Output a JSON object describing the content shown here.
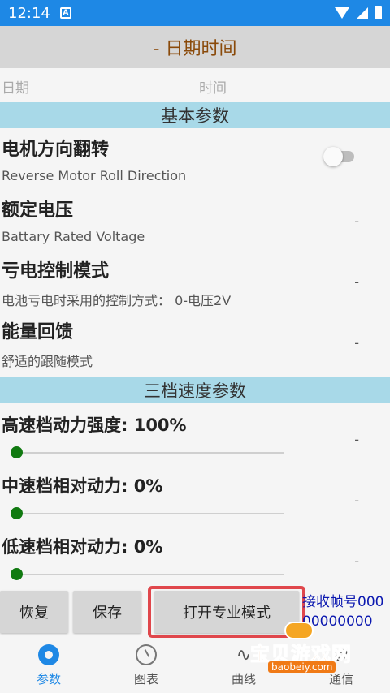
{
  "status_bar": {
    "time": "12:14",
    "notif_icon": "A"
  },
  "header": {
    "title": "- 日期时间"
  },
  "datetime": {
    "date_label": "日期",
    "time_label": "时间"
  },
  "sections": {
    "basic": "基本参数",
    "speed": "三档速度参数"
  },
  "settings": [
    {
      "title": "电机方向翻转",
      "subtitle": "Reverse Motor Roll Direction",
      "control": "toggle",
      "on": false
    },
    {
      "title": "额定电压",
      "subtitle": "Battary Rated Voltage",
      "value": "-"
    },
    {
      "title": "亏电控制模式",
      "subtitle": "电池亏电时采用的控制方式：  0-电压2V",
      "value": "-"
    },
    {
      "title": "能量回馈",
      "subtitle": "舒适的跟随模式",
      "value": "-"
    }
  ],
  "speed_sliders": [
    {
      "label": "高速档动力强度: 100%",
      "level": 0,
      "value": "-"
    },
    {
      "label": "中速档相对动力: 0%",
      "level": 0,
      "value": "-"
    },
    {
      "label": "低速档相对动力: 0%",
      "level": 0,
      "value": "-"
    }
  ],
  "buttons": {
    "restore": "恢复",
    "save": "保存",
    "pro_mode": "打开专业模式"
  },
  "frame_info": {
    "line1": "接收帧号000",
    "line2": "00000000"
  },
  "bottom_nav": [
    {
      "label": "参数",
      "icon": "gear-icon",
      "active": true
    },
    {
      "label": "图表",
      "icon": "gauge-icon",
      "active": false
    },
    {
      "label": "曲线",
      "icon": "curve-icon",
      "active": false
    },
    {
      "label": "通信",
      "icon": "communication-icon",
      "active": false
    }
  ],
  "watermark": {
    "text": "宝贝游戏网",
    "url": "baobeiy.com"
  },
  "colors": {
    "primary": "#1e88e5",
    "section_bar": "#a8d9e8",
    "header_text": "#8a4a0a",
    "slider_accent": "#117a11",
    "highlight": "#e0474c",
    "frame_info_text": "#0b18b0"
  }
}
